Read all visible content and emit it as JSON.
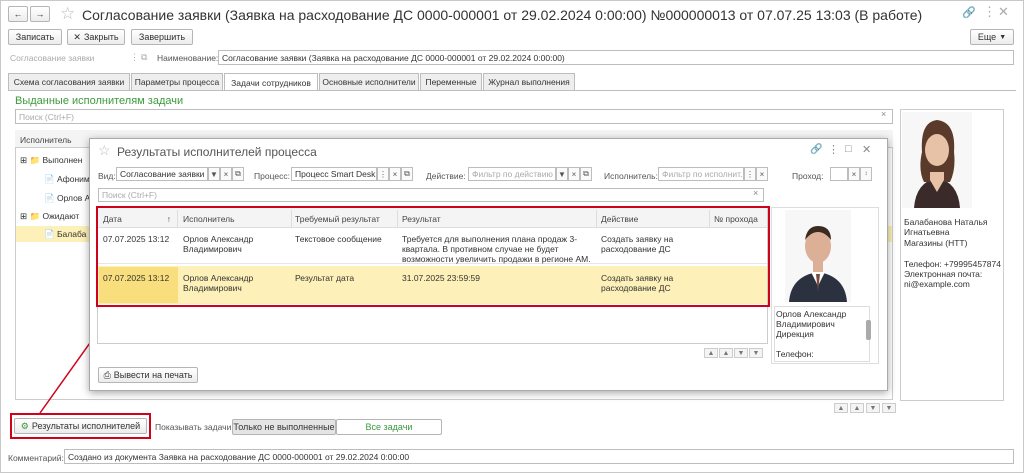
{
  "window": {
    "title": "Согласование заявки (Заявка на расходование ДС 0000-000001 от 29.02.2024 0:00:00) №000000013 от 07.07.25 13:03 (В работе)"
  },
  "toolbar": {
    "save": "Записать",
    "close": "Закрыть",
    "finish": "Завершить",
    "more": "Еще"
  },
  "header": {
    "type_placeholder": "Согласование заявки",
    "name_label": "Наименование:",
    "name_value": "Согласование заявки (Заявка на расходование ДС 0000-000001 от 29.02.2024 0:00:00)"
  },
  "tabs": [
    "Схема согласования заявки",
    "Параметры процесса",
    "Задачи сотрудников",
    "Основные исполнители",
    "Переменные",
    "Журнал выполнения"
  ],
  "tasks": {
    "section_title": "Выданные исполнителям задачи",
    "search_placeholder": "Поиск (Ctrl+F)",
    "col_executor": "Исполнитель",
    "tree": [
      "Выполнен",
      "Афоним",
      "Орлов А",
      "Ожидают",
      "Балаба"
    ]
  },
  "right_panel": {
    "name": "Балабанова Наталья Игнатьевна",
    "company": "Магазины (НТТ)",
    "phone": "Телефон: +79995457874",
    "email_label": "Электронная почта:",
    "email": "ni@example.com"
  },
  "bottom": {
    "results_button": "Результаты исполнителей",
    "show_tasks_label": "Показывать задачи:",
    "only_unfinished": "Только не выполненные",
    "all_tasks": "Все задачи",
    "comment_label": "Комментарий:",
    "comment_value": "Создано из документа Заявка на расходование ДС 0000-000001 от 29.02.2024 0:00:00"
  },
  "dialog": {
    "title": "Результаты исполнителей процесса",
    "view_label": "Вид:",
    "view_value": "Согласование заявки",
    "process_label": "Процесс:",
    "process_value": "Процесс Smart Desk (",
    "action_label": "Действие:",
    "action_placeholder": "Фильтр по действию",
    "executor_label": "Исполнитель:",
    "executor_placeholder": "Фильтр по исполнит...",
    "pass_label": "Проход:",
    "search_placeholder": "Поиск (Ctrl+F)",
    "columns": [
      "Дата",
      "Исполнитель",
      "Требуемый результат",
      "Результат",
      "Действие",
      "№ прохода"
    ],
    "rows": [
      {
        "date": "07.07.2025 13:12",
        "executor": "Орлов Александр Владимирович",
        "required": "Текстовое сообщение",
        "result": "Требуется для выполнения плана продаж 3-квартала. В противном случае не будет возможности увеличить продажи в регионе АМ.",
        "action": "Создать заявку на расходование ДС",
        "pass": ""
      },
      {
        "date": "07.07.2025 13:12",
        "executor": "Орлов Александр Владимирович",
        "required": "Результат дата",
        "result": "31.07.2025 23:59:59",
        "action": "Создать заявку на расходование ДС",
        "pass": ""
      }
    ],
    "person_name": "Орлов Александр Владимирович",
    "person_dept": "Дирекция",
    "person_phone": "Телефон:",
    "print_button": "Вывести на печать"
  },
  "colors": {
    "accent_green": "#3c9a3c",
    "highlight_red": "#d0021b",
    "row_selected": "#fdf0b8"
  }
}
